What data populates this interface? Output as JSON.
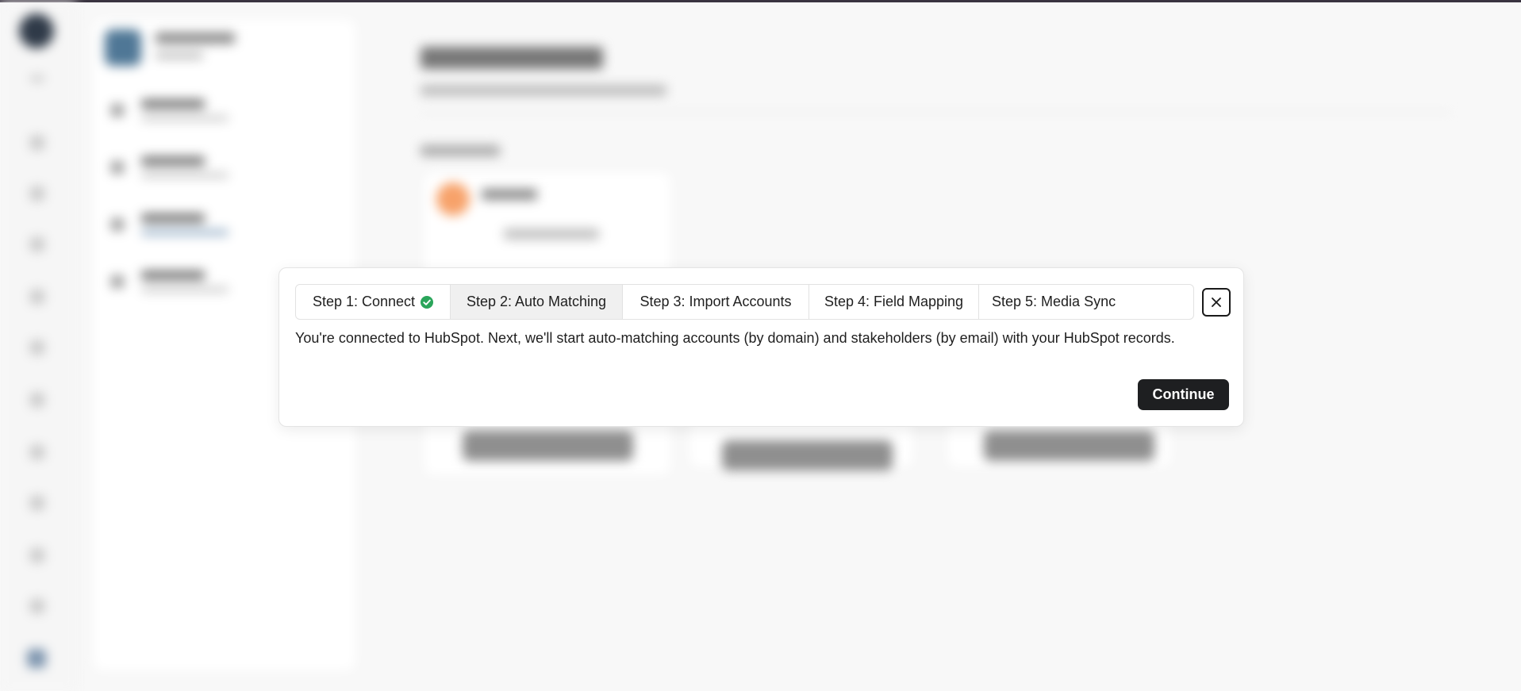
{
  "modal": {
    "steps": [
      {
        "label": "Step 1: Connect",
        "completed": true,
        "active": false
      },
      {
        "label": "Step 2: Auto Matching",
        "completed": false,
        "active": true
      },
      {
        "label": "Step 3: Import Accounts",
        "completed": false,
        "active": false
      },
      {
        "label": "Step 4: Field Mapping",
        "completed": false,
        "active": false
      },
      {
        "label": "Step 5: Media Sync",
        "completed": false,
        "active": false
      }
    ],
    "message": "You're connected to HubSpot. Next, we'll start auto-matching accounts (by domain) and stakeholders (by email) with your HubSpot records.",
    "continue_label": "Continue",
    "close_icon": "close-icon",
    "check_icon": "check-circle-icon"
  },
  "colors": {
    "success": "#2aa55a",
    "primary_button": "#1e1f21",
    "active_step_bg": "#f0f0f0"
  }
}
